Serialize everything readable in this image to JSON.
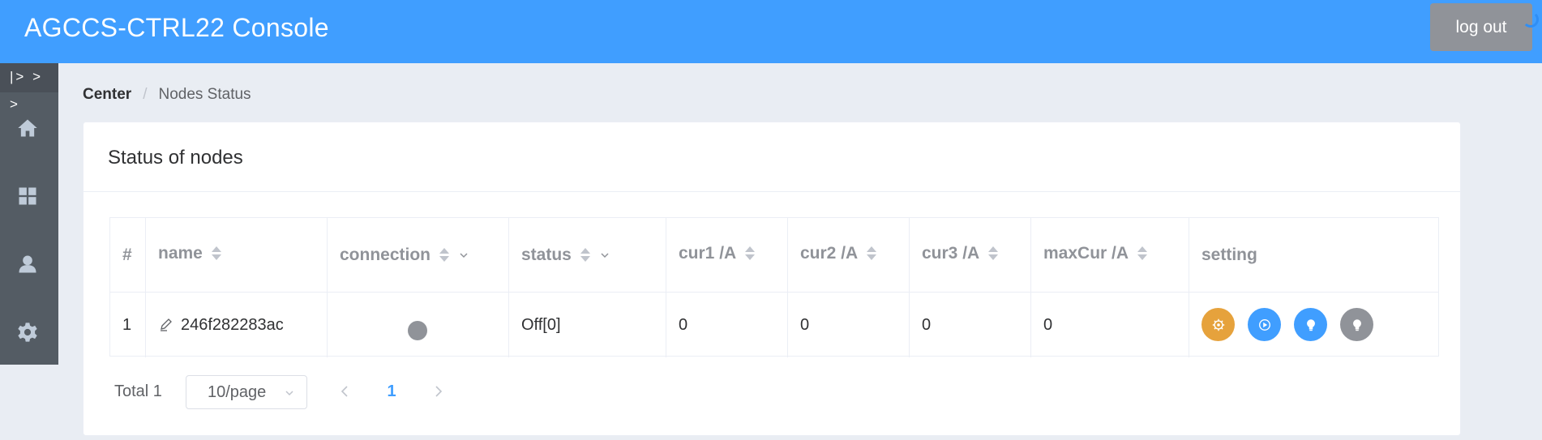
{
  "header": {
    "title": "AGCCS-CTRL22 Console",
    "logout_label": "log out"
  },
  "sidebar": {
    "toggle_label": "|> > >",
    "items": [
      {
        "icon": "home-icon"
      },
      {
        "icon": "grid-icon"
      },
      {
        "icon": "user-icon"
      },
      {
        "icon": "gear-icon"
      }
    ]
  },
  "breadcrumb": {
    "root": "Center",
    "separator": "/",
    "current": "Nodes Status"
  },
  "card": {
    "title": "Status of nodes"
  },
  "table": {
    "columns": [
      {
        "label": "#",
        "sortable": false,
        "filterable": false
      },
      {
        "label": "name",
        "sortable": true,
        "filterable": false
      },
      {
        "label": "connection",
        "sortable": true,
        "filterable": true
      },
      {
        "label": "status",
        "sortable": true,
        "filterable": true
      },
      {
        "label": "cur1 /A",
        "sortable": true,
        "filterable": false
      },
      {
        "label": "cur2 /A",
        "sortable": true,
        "filterable": false
      },
      {
        "label": "cur3 /A",
        "sortable": true,
        "filterable": false
      },
      {
        "label": "maxCur /A",
        "sortable": true,
        "filterable": false
      },
      {
        "label": "setting",
        "sortable": false,
        "filterable": false
      }
    ],
    "rows": [
      {
        "index": "1",
        "name": "246f282283ac",
        "connection": "disconnected",
        "status": "Off[0]",
        "cur1": "0",
        "cur2": "0",
        "cur3": "0",
        "maxCur": "0",
        "setting_buttons": [
          {
            "icon": "settings-icon",
            "color": "#e6a23c"
          },
          {
            "icon": "play-icon",
            "color": "#409eff"
          },
          {
            "icon": "bulb-icon",
            "color": "#409eff"
          },
          {
            "icon": "bulb-icon",
            "color": "#909399"
          }
        ]
      }
    ]
  },
  "pagination": {
    "total_label": "Total 1",
    "page_size": "10/page",
    "current_page": "1"
  },
  "colors": {
    "primary": "#409eff",
    "header_bg": "#409eff",
    "sidebar_bg": "#545c64",
    "warning": "#e6a23c",
    "info": "#909399"
  }
}
